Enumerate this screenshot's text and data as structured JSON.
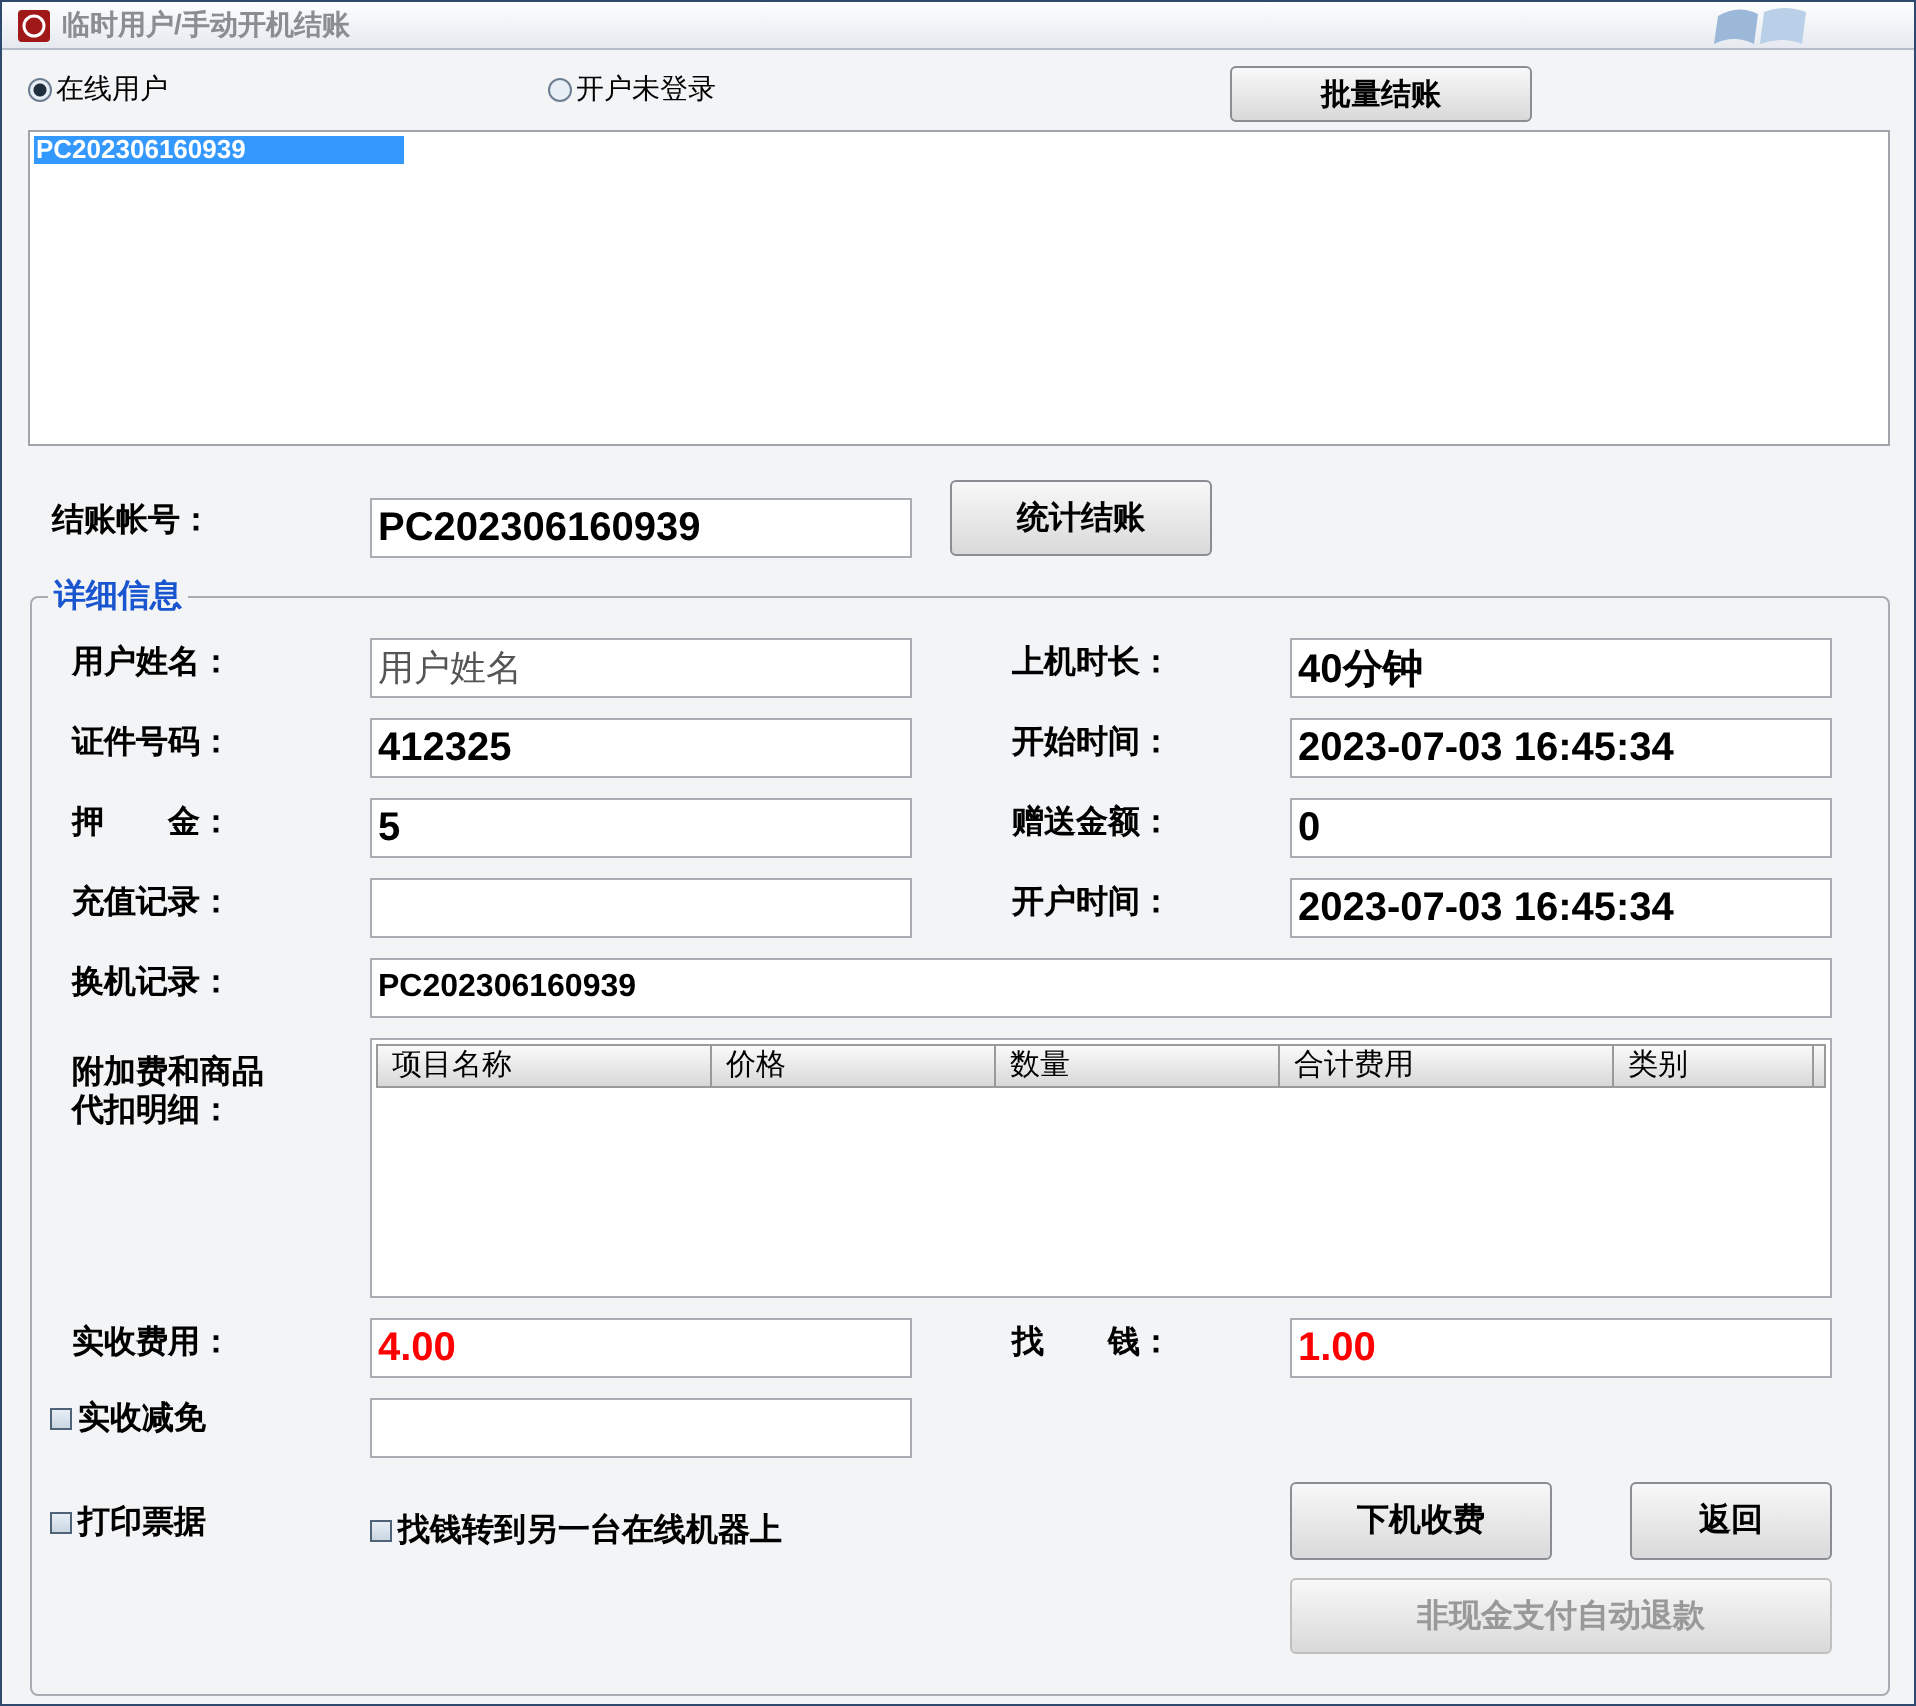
{
  "window": {
    "title": "临时用户/手动开机结账"
  },
  "user_filter": [
    {
      "label": "在线用户",
      "selected": true
    },
    {
      "label": "开户未登录",
      "selected": false
    }
  ],
  "batch_button": "批量结账",
  "user_list": [
    {
      "label": "PC202306160939",
      "selected": true
    }
  ],
  "account": {
    "label": "结账帐号：",
    "value": "PC202306160939"
  },
  "tally_button": "统计结账",
  "details": {
    "legend": "详细信息",
    "fields": [
      {
        "label": "用户姓名：",
        "placeholder": "用户姓名"
      },
      {
        "label": "上机时长：",
        "value": "**40**分钟"
      },
      {
        "label": "证件号码：",
        "value": "412325"
      },
      {
        "label": "开始时间：",
        "value": "2023-07-03 16:45:34"
      },
      {
        "label": "押　　金：",
        "value": "5"
      },
      {
        "label": "赠送金额：",
        "value": "0"
      },
      {
        "label": "充值记录："
      },
      {
        "label": "开户时间：",
        "value": "2023-07-03 16:45:34"
      }
    ],
    "transfer_record": {
      "label": "换机记录：",
      "value": "PC202306160939"
    },
    "extras": {
      "label": "附加费和商品代扣明细：",
      "columns": [
        "项目名称",
        "价格",
        "数量",
        "合计费用",
        "类别"
      ]
    },
    "received": {
      "label": "实收费用：",
      "value": "4.00"
    },
    "change": {
      "label": "找　　钱：",
      "value": "1.00"
    },
    "discount": {
      "label": "实收减免",
      "checked": false
    },
    "print_receipt": {
      "label": "打印票据",
      "checked": false
    },
    "transfer_change": {
      "label": "找钱转到另一台在线机器上",
      "checked": false
    },
    "buttons": [
      {
        "label": "下机收费",
        "disabled": false
      },
      {
        "label": "返回",
        "disabled": false
      },
      {
        "label": "非现金支付自动退款",
        "disabled": true
      }
    ]
  }
}
